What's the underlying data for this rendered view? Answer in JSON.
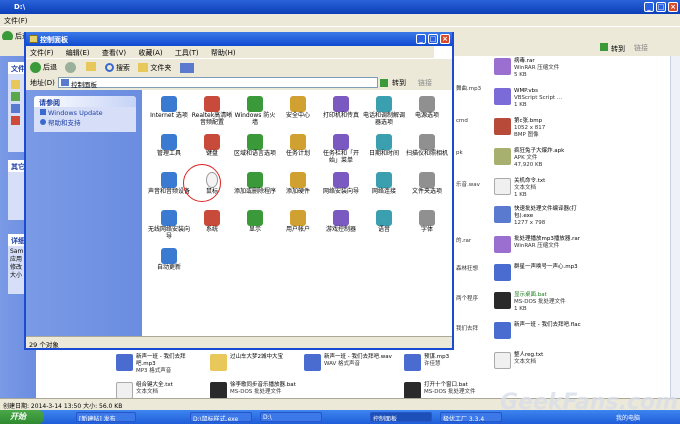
{
  "back_window": {
    "title": "D:\\",
    "menu": [
      "文件(F)"
    ],
    "toolbar_label": "后退",
    "left_panels": [
      "文件",
      "其它",
      "详细"
    ],
    "left_text": [
      "Sam",
      "应用",
      "修改",
      "大小"
    ],
    "go_label": "转到",
    "links_label": "链接",
    "status": "创建日期: 2014-3-14 13:50 大小: 56.0 KB",
    "files": [
      {
        "name": "病毒.rar",
        "sub1": "WinRAR 压缩文件",
        "sub2": "5 KB",
        "color": "#9a6fd0"
      },
      {
        "name": "WMP.vbs",
        "sub1": "VBScript Script ...",
        "sub2": "1 KB",
        "color": "#7b6bd8"
      },
      {
        "name": "第c张.bmp",
        "sub1": "1052 x 817",
        "sub2": "BMP 图像",
        "color": "#b84a3a"
      },
      {
        "name": "疯狂兔子大爆炸.apk",
        "sub1": "APK 文件",
        "sub2": "47,920 KB",
        "color": "#a8b070"
      },
      {
        "name": "关机命令.txt",
        "sub1": "文本文档",
        "sub2": "1 KB",
        "color": "#f0f0f0"
      },
      {
        "name": "快速批处理文件编译器(打包).exe",
        "sub1": "1277 x 798",
        "sub2": "",
        "color": "#5a7ad0"
      },
      {
        "name": "批处理播放mp3播放器.rar",
        "sub1": "WinRAR 压缩文件",
        "sub2": "",
        "color": "#9a6fd0"
      },
      {
        "name": "群星一声唤号一声心.mp3",
        "sub1": "",
        "sub2": "",
        "color": "#4a6bd0"
      },
      {
        "name": "显示桌面.bat",
        "sub1": "MS-DOS 批处理文件",
        "sub2": "1 KB",
        "color": "#2a2a2a"
      },
      {
        "name": "新声一班 - 我们去拜吧.flac",
        "sub1": "",
        "sub2": "",
        "color": "#4a6bd0"
      },
      {
        "name": "整人reg.txt",
        "sub1": "文本文档",
        "sub2": "",
        "color": "#f0f0f0"
      }
    ],
    "mid_fragments": [
      "舞曲.mp3",
      "cmd",
      "pk",
      "乐音.wav",
      "的.rar",
      "森林狂想",
      "两个程序",
      "我们去拜"
    ],
    "bottom_files": [
      {
        "name": "新声一班 - 我们去拜吧.mp3",
        "sub": "MP3 格式声音"
      },
      {
        "name": "过山车大梦2城中大宝",
        "sub": ""
      },
      {
        "name": "新声一班 - 我们去拜吧.wav",
        "sub": "WAV 格式声音"
      },
      {
        "name": "预谋.mp3",
        "sub": "许佳慧"
      },
      {
        "name": "组合键大全.txt",
        "sub": "文本文档"
      },
      {
        "name": "徐李歌同步音乐播放器.bat",
        "sub": "MS-DOS 批处理文件"
      },
      {
        "name": "打开十个窗口.bat",
        "sub": "MS-DOS 批处理文件"
      }
    ]
  },
  "control_panel": {
    "title": "控制面板",
    "menu": [
      "文件(F)",
      "编辑(E)",
      "查看(V)",
      "收藏(A)",
      "工具(T)",
      "帮助(H)"
    ],
    "toolbar": {
      "back": "后退",
      "search": "搜索",
      "folders": "文件夹"
    },
    "address_label": "地址(D)",
    "address_value": "控制面板",
    "go_label": "转到",
    "links_label": "链接",
    "see_also_title": "请参阅",
    "see_also_items": [
      "Windows Update",
      "帮助和支持"
    ],
    "status": "29 个对象",
    "icons": [
      [
        "Internet 选项",
        "Realtek高清晰音频配置",
        "Windows 防火墙",
        "安全中心",
        "打印机和传真",
        "电话和调制解调器选项",
        "电源选项"
      ],
      [
        "管理工具",
        "键盘",
        "区域和语言选项",
        "任务计划",
        "任务栏和「开始」菜单",
        "日期和时间",
        "扫描仪和照相机"
      ],
      [
        "声音和音频设备",
        "鼠标",
        "添加或删除程序",
        "添加硬件",
        "网络安装向导",
        "网络连接",
        "文件夹选项"
      ],
      [
        "无线网络安装向导",
        "系统",
        "显示",
        "用户帐户",
        "游戏控制器",
        "语音",
        "字体"
      ],
      [
        "自动更新"
      ]
    ]
  },
  "taskbar": {
    "start": "开始",
    "tasks": [
      "[新建帖] 发布",
      "D:\\鼠标样式.exe",
      "D:\\",
      "控制面板",
      "极优工厂 3.3.4"
    ],
    "tray": "我的电脑"
  },
  "watermark": "GeekFans.com",
  "colors": {
    "title_blue": "#0f4ad0",
    "panel_blue": "#6b8de0",
    "highlight_red": "#dd2222"
  }
}
